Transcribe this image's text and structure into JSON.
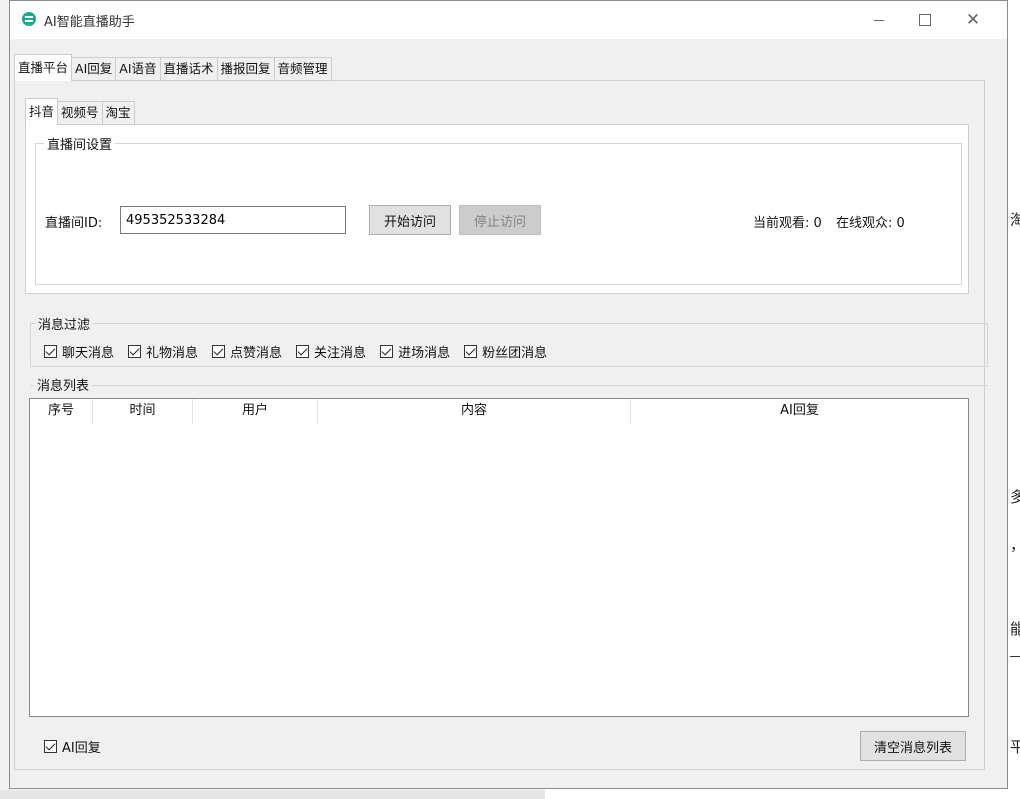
{
  "window": {
    "title": "AI智能直播助手"
  },
  "main_tabs": [
    "直播平台",
    "AI回复",
    "AI语音",
    "直播话术",
    "播报回复",
    "音频管理"
  ],
  "platform_tabs": [
    "抖音",
    "视频号",
    "淘宝"
  ],
  "room_settings": {
    "group_label": "直播间设置",
    "id_label": "直播间ID:",
    "id_value": "495352533284",
    "start_button": "开始访问",
    "stop_button": "停止访问",
    "current_viewers": "当前观看: 0",
    "online_viewers": "在线观众: 0"
  },
  "message_filter": {
    "group_label": "消息过滤",
    "options": [
      "聊天消息",
      "礼物消息",
      "点赞消息",
      "关注消息",
      "进场消息",
      "粉丝团消息"
    ]
  },
  "message_list": {
    "group_label": "消息列表",
    "columns": [
      "序号",
      "时间",
      "用户",
      "内容",
      "AI回复"
    ]
  },
  "footer": {
    "ai_reply_label": "AI回复",
    "clear_button": "清空消息列表"
  },
  "background_fragments": [
    "淘",
    "多",
    "，",
    "能",
    "平"
  ]
}
